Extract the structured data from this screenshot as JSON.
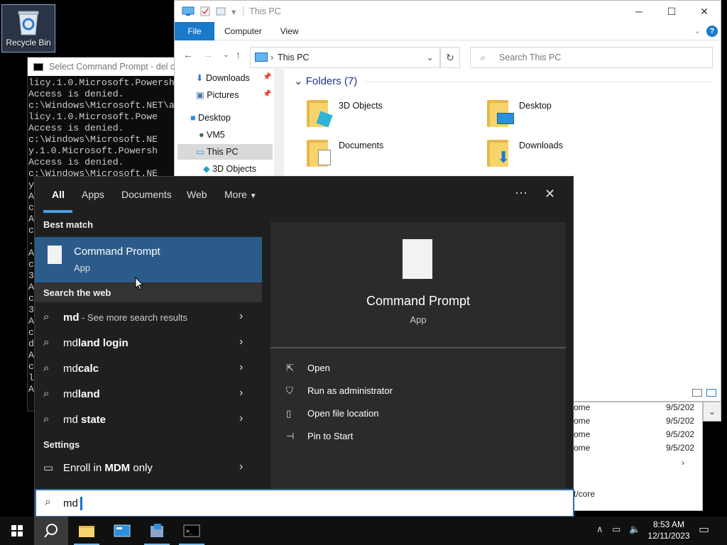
{
  "desktop": {
    "recycle_bin_label": "Recycle Bin"
  },
  "cmd": {
    "title": "Select Command Prompt - del  c:",
    "lines": [
      "licy.1.0.Microsoft.Powersh",
      "Access is denied.",
      "c:\\Windows\\Microsoft.NET\\a",
      "licy.1.0.Microsoft.Powe",
      "Access is denied.",
      "c:\\Windows\\Microsoft.NE",
      "y.1.0.Microsoft.Powersh",
      "Access is denied.",
      "c:\\Windows\\Microsoft.NE",
      "y",
      "A",
      "c",
      "A",
      "c",
      ".",
      "A",
      "c",
      "3",
      "A",
      "c",
      "3",
      "A",
      "c",
      "d",
      "A",
      "c",
      "l",
      "A"
    ]
  },
  "explorer": {
    "title": "This PC",
    "ribbon": {
      "file": "File",
      "computer": "Computer",
      "view": "View"
    },
    "address": "This PC",
    "search_placeholder": "Search This PC",
    "nav": [
      "Downloads",
      "Pictures",
      "Desktop",
      "VM5",
      "This PC",
      "3D Objects"
    ],
    "folders_header": "Folders (7)",
    "folders": [
      "3D Objects",
      "Desktop",
      "Documents",
      "Downloads"
    ]
  },
  "lower_window": {
    "rows": [
      {
        "name": "ome",
        "date": "9/5/202"
      },
      {
        "name": "ome",
        "date": "9/5/202"
      },
      {
        "name": "ome",
        "date": "9/5/202"
      },
      {
        "name": "ome",
        "date": "9/5/202"
      }
    ],
    "path_fragment": "t/core"
  },
  "start": {
    "tabs": [
      "All",
      "Apps",
      "Documents",
      "Web",
      "More"
    ],
    "best_match_label": "Best match",
    "best_match": {
      "name": "Command Prompt",
      "type": "App"
    },
    "web_label": "Search the web",
    "web_results": [
      {
        "bold": "md",
        "rest": " - See more search results"
      },
      {
        "bold": "md",
        "rest": "land login"
      },
      {
        "bold": "md",
        "rest": "calc"
      },
      {
        "bold": "md",
        "rest": "land"
      },
      {
        "bold": "md",
        "rest": " state"
      }
    ],
    "settings_label": "Settings",
    "settings_result": {
      "pre": "Enroll in ",
      "bold": "MDM",
      "post": " only"
    },
    "preview": {
      "name": "Command Prompt",
      "type": "App"
    },
    "actions": [
      "Open",
      "Run as administrator",
      "Open file location",
      "Pin to Start"
    ],
    "query": "md"
  },
  "taskbar": {
    "time": "8:53 AM",
    "date": "12/11/2023"
  },
  "colors": {
    "accent": "#4ba0e8",
    "selection": "#2c5b8a",
    "file_tab": "#1979ca"
  }
}
